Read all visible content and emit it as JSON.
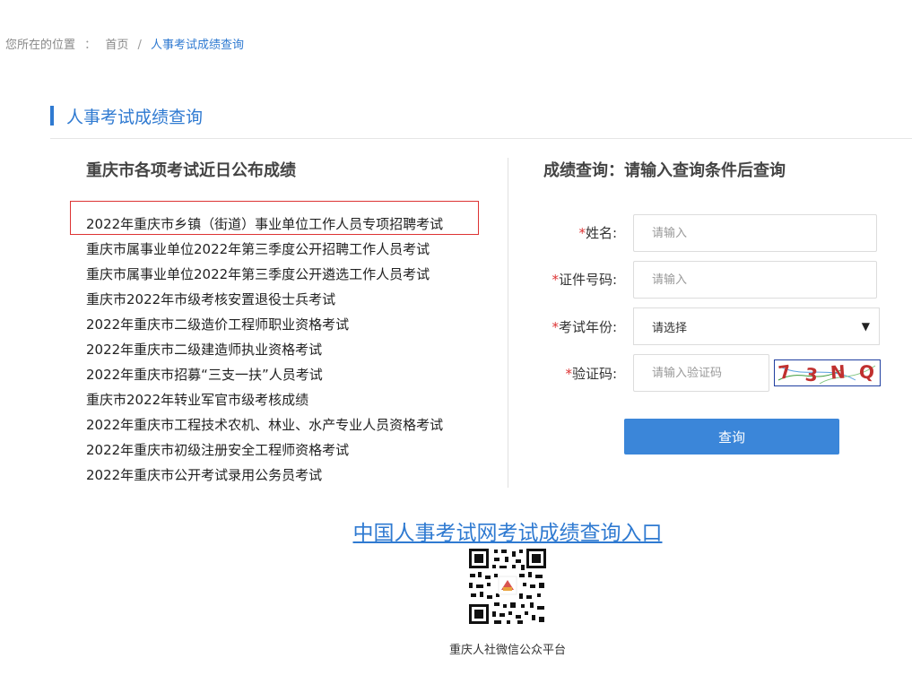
{
  "breadcrumb": {
    "prefix": "您所在的位置",
    "colon": "：",
    "home": "首页",
    "separator": "/",
    "current": "人事考试成绩查询"
  },
  "section": {
    "title": "人事考试成绩查询"
  },
  "left": {
    "heading": "重庆市各项考试近日公布成绩",
    "exams": [
      "2022年重庆市乡镇（街道）事业单位工作人员专项招聘考试",
      "重庆市属事业单位2022年第三季度公开招聘工作人员考试",
      "重庆市属事业单位2022年第三季度公开遴选工作人员考试",
      "重庆市2022年市级考核安置退役士兵考试",
      "2022年重庆市二级造价工程师职业资格考试",
      "2022年重庆市二级建造师执业资格考试",
      "2022年重庆市招募“三支一扶”人员考试",
      "重庆市2022年转业军官市级考核成绩",
      "2022年重庆市工程技术农机、林业、水产专业人员资格考试",
      "2022年重庆市初级注册安全工程师资格考试",
      "2022年重庆市公开考试录用公务员考试"
    ]
  },
  "right": {
    "heading": "成绩查询：请输入查询条件后查询",
    "required_mark": "*",
    "fields": {
      "name": {
        "label": "姓名:",
        "placeholder": "请输入"
      },
      "id": {
        "label": "证件号码:",
        "placeholder": "请输入"
      },
      "year": {
        "label": "考试年份:",
        "value": "请选择"
      },
      "captcha": {
        "label": "验证码:",
        "placeholder": "请输入验证码",
        "chars": [
          "7",
          "3",
          "N",
          "Q"
        ]
      }
    },
    "submit_label": "查询"
  },
  "footer": {
    "portal_link": "中国人事考试网考试成绩查询入口",
    "qr_caption": "重庆人社微信公众平台"
  },
  "colors": {
    "accent": "#2f7ad1",
    "button": "#3b86d9",
    "required": "#d33333"
  }
}
